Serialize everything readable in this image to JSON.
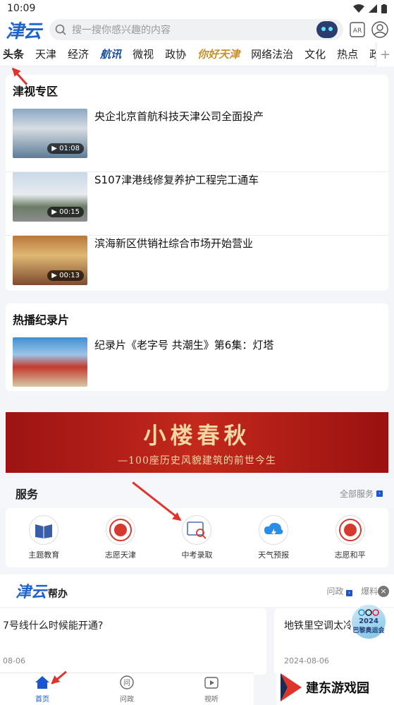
{
  "status": {
    "time": "10:09"
  },
  "header": {
    "logo": "津云",
    "search_placeholder": "搜一搜你感兴趣的内容",
    "ar_label": "AR"
  },
  "channels": [
    {
      "label": "头条",
      "style": "active"
    },
    {
      "label": "天津",
      "style": ""
    },
    {
      "label": "经济",
      "style": ""
    },
    {
      "label": "航讯",
      "style": "special"
    },
    {
      "label": "微视",
      "style": ""
    },
    {
      "label": "政协",
      "style": ""
    },
    {
      "label": "你好天津",
      "style": "gold"
    },
    {
      "label": "网络法治",
      "style": ""
    },
    {
      "label": "文化",
      "style": ""
    },
    {
      "label": "热点",
      "style": ""
    },
    {
      "label": "政情",
      "style": ""
    }
  ],
  "plus_label": "+",
  "tv_section": {
    "title": "津视专区",
    "videos": [
      {
        "title": "央企北京首航科技天津公司全面投产",
        "duration": "01:08"
      },
      {
        "title": "S107津港线修复养护工程完工通车",
        "duration": "00:15"
      },
      {
        "title": "滨海新区供销社综合市场开始营业",
        "duration": "00:13"
      }
    ]
  },
  "doc_section": {
    "title": "热播纪录片",
    "items": [
      {
        "title": "纪录片《老字号 共潮生》第6集：灯塔"
      }
    ]
  },
  "banner": {
    "title": "小楼春秋",
    "subtitle": "—100座历史风貌建筑的前世今生"
  },
  "services": {
    "title": "服务",
    "all_label": "全部服务",
    "items": [
      {
        "label": "主题教育",
        "icon": "book-icon"
      },
      {
        "label": "志愿天津",
        "icon": "volunteer-icon"
      },
      {
        "label": "中考录取",
        "icon": "exam-search-icon"
      },
      {
        "label": "天气预报",
        "icon": "weather-icon"
      },
      {
        "label": "志愿和平",
        "icon": "volunteer-peace-icon"
      }
    ]
  },
  "help": {
    "logo": "津云",
    "suffix": "帮办",
    "tabs": [
      "问政",
      "爆料"
    ],
    "cards": [
      {
        "question": "7号线什么时候能开通?",
        "date": "08-06"
      },
      {
        "question": "地铁里空调太冷",
        "date": "2024-08-06"
      }
    ]
  },
  "olympic_badge": {
    "year": "2024",
    "label": "巴黎奥运会"
  },
  "tabbar": [
    {
      "label": "首页",
      "active": true
    },
    {
      "label": "问政",
      "active": false
    },
    {
      "label": "视听",
      "active": false
    }
  ],
  "watermark": {
    "text": "建东游戏园"
  },
  "colors": {
    "brand": "#1f63c8",
    "accent": "#1a56d0",
    "arrow": "#e0332b",
    "banner": "#b31f18"
  }
}
